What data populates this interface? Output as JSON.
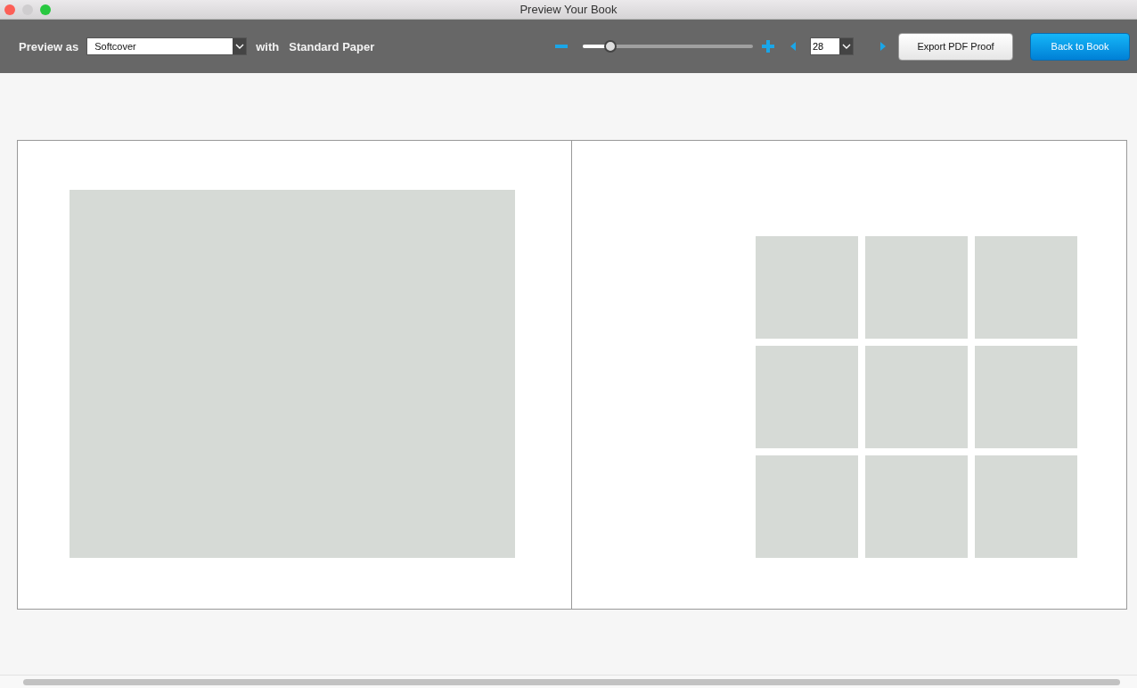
{
  "window": {
    "title": "Preview Your Book"
  },
  "toolbar": {
    "preview_label": "Preview as",
    "format": {
      "value": "Softcover"
    },
    "with_label": "with",
    "paper": "Standard Paper",
    "zoom": {
      "level": 0.17
    },
    "page": {
      "value": "28"
    },
    "buttons": [
      {
        "label": "Export PDF Proof",
        "kind": "default"
      },
      {
        "label": "Back to Book",
        "kind": "primary"
      }
    ]
  },
  "spread": {
    "left_page": {
      "frames": [
        {
          "kind": "placeholder"
        }
      ]
    },
    "right_page": {
      "frames": [
        {
          "kind": "placeholder"
        },
        {
          "kind": "placeholder"
        },
        {
          "kind": "placeholder"
        },
        {
          "kind": "placeholder"
        },
        {
          "kind": "placeholder"
        },
        {
          "kind": "placeholder"
        },
        {
          "kind": "placeholder"
        },
        {
          "kind": "placeholder"
        },
        {
          "kind": "placeholder"
        }
      ]
    }
  }
}
